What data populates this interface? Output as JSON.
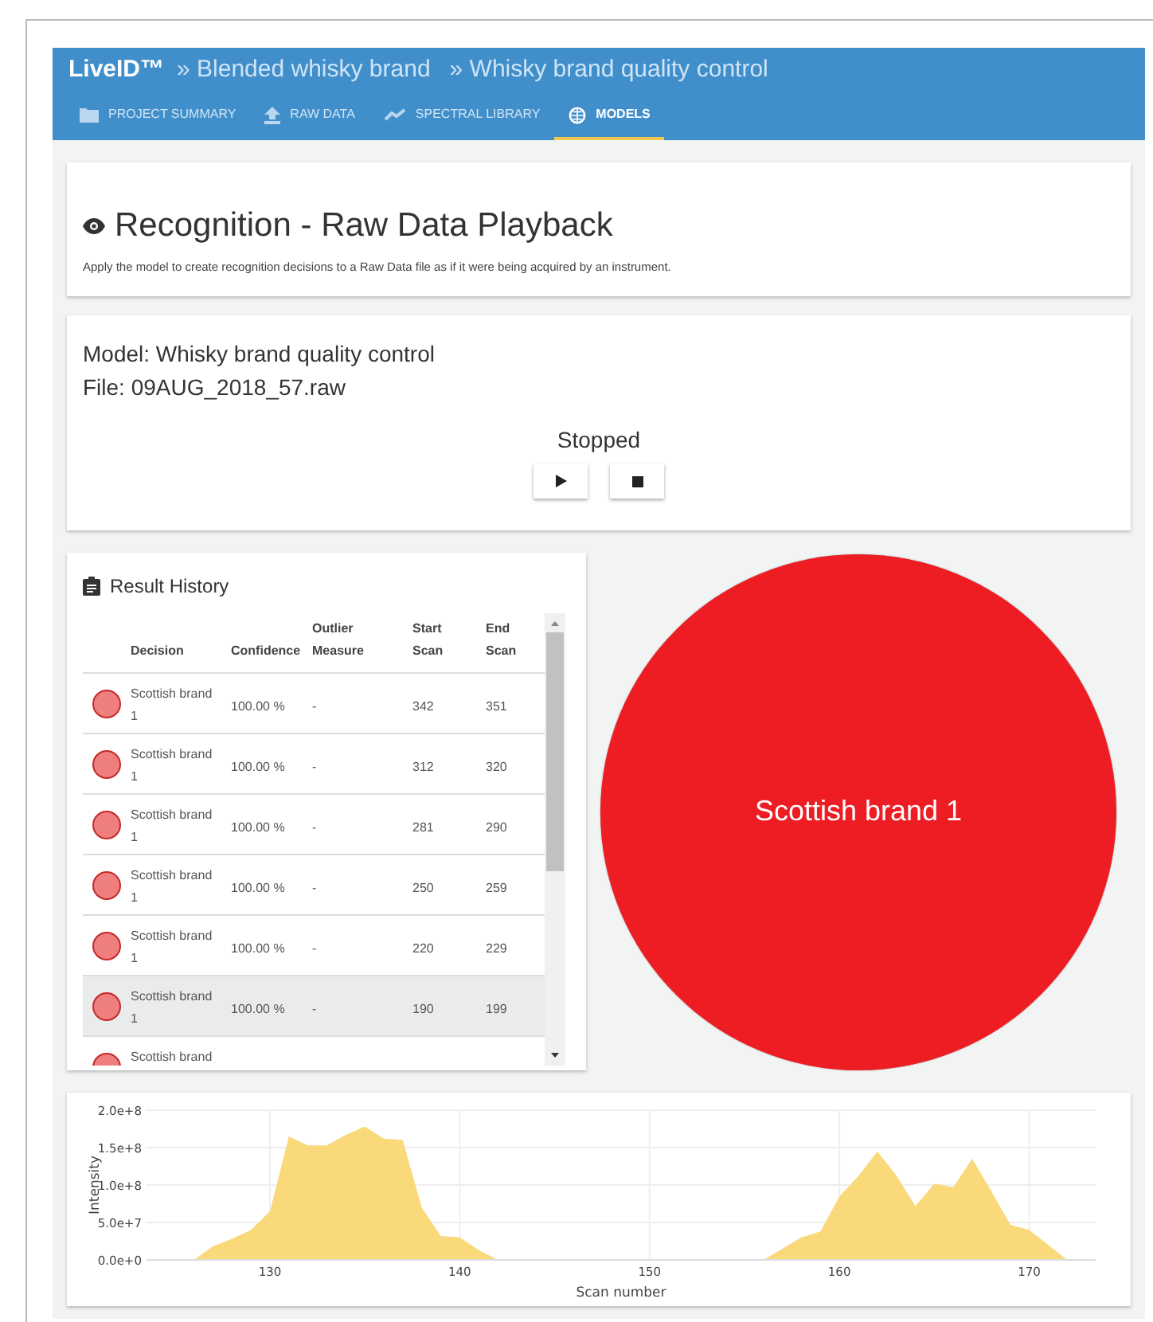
{
  "header": {
    "brand": "LiveID™",
    "breadcrumbs": [
      "» Blended whisky brand",
      "» Whisky brand quality control"
    ]
  },
  "tabs": [
    {
      "label": "PROJECT SUMMARY",
      "selected": false
    },
    {
      "label": "RAW DATA",
      "selected": false
    },
    {
      "label": "SPECTRAL LIBRARY",
      "selected": false
    },
    {
      "label": "MODELS",
      "selected": true
    }
  ],
  "intro": {
    "title": "Recognition - Raw Data Playback",
    "description": "Apply the model to create recognition decisions to a Raw Data file as if it were being acquired by an instrument."
  },
  "playback": {
    "model": "Model: Whisky brand quality control",
    "file": "File: 09AUG_2018_57.raw",
    "status": "Stopped"
  },
  "result_history": {
    "title": "Result History",
    "columns": [
      "Decision",
      "Confidence",
      "Outlier Measure",
      "Start Scan",
      "End Scan"
    ],
    "rows": [
      {
        "color": "#ef7f7f",
        "decision": "Scottish brand 1",
        "confidence": "100.00 %",
        "outlier": "-",
        "start": "342",
        "end": "351",
        "selected": false
      },
      {
        "color": "#ef7f7f",
        "decision": "Scottish brand 1",
        "confidence": "100.00 %",
        "outlier": "-",
        "start": "312",
        "end": "320",
        "selected": false
      },
      {
        "color": "#ef7f7f",
        "decision": "Scottish brand 1",
        "confidence": "100.00 %",
        "outlier": "-",
        "start": "281",
        "end": "290",
        "selected": false
      },
      {
        "color": "#ef7f7f",
        "decision": "Scottish brand 1",
        "confidence": "100.00 %",
        "outlier": "-",
        "start": "250",
        "end": "259",
        "selected": false
      },
      {
        "color": "#ef7f7f",
        "decision": "Scottish brand 1",
        "confidence": "100.00 %",
        "outlier": "-",
        "start": "220",
        "end": "229",
        "selected": false
      },
      {
        "color": "#ef7f7f",
        "decision": "Scottish brand 1",
        "confidence": "100.00 %",
        "outlier": "-",
        "start": "190",
        "end": "199",
        "selected": true
      },
      {
        "color": "#ef7f7f",
        "decision": "Scottish brand",
        "selected": false
      }
    ]
  },
  "decision": {
    "label": "Scottish brand 1",
    "color": "#ee1d24"
  },
  "spectrum": {
    "chart_data": {
      "type": "area",
      "xlabel": "Scan number",
      "ylabel": "Intensity",
      "xlim": [
        123.5,
        173.5
      ],
      "ylim": [
        0,
        200000000
      ],
      "grid": true,
      "xticks": [
        130,
        140,
        150,
        160,
        170
      ],
      "yticks": [
        {
          "value": 0,
          "label": "0.0e+0"
        },
        {
          "value": 50000000,
          "label": "5.0e+7"
        },
        {
          "value": 100000000,
          "label": "1.0e+8"
        },
        {
          "value": 150000000,
          "label": "1.5e+8"
        },
        {
          "value": 200000000,
          "label": "2.0e+8"
        }
      ],
      "x": [
        124,
        125,
        126,
        127,
        128,
        129,
        130,
        131,
        132,
        133,
        134,
        135,
        136,
        137,
        138,
        139,
        140,
        141,
        142,
        143,
        144,
        145,
        146,
        147,
        148,
        149,
        150,
        151,
        152,
        153,
        154,
        155,
        156,
        157,
        158,
        159,
        160,
        161,
        162,
        163,
        164,
        165,
        166,
        167,
        168,
        169,
        170,
        171,
        172,
        173
      ],
      "series": [
        {
          "color": "#fad97a",
          "values": [
            0,
            0,
            0,
            18000000,
            28000000,
            40000000,
            65000000,
            165000000,
            153000000,
            153000000,
            167000000,
            178000000,
            162000000,
            160000000,
            70000000,
            32000000,
            30000000,
            13000000,
            0,
            0,
            0,
            0,
            0,
            0,
            0,
            0,
            0,
            0,
            0,
            0,
            0,
            0,
            0,
            15000000,
            30000000,
            38000000,
            85000000,
            112000000,
            145000000,
            113000000,
            72000000,
            102000000,
            97000000,
            135000000,
            92000000,
            47000000,
            40000000,
            20000000,
            0,
            0
          ]
        }
      ]
    }
  }
}
